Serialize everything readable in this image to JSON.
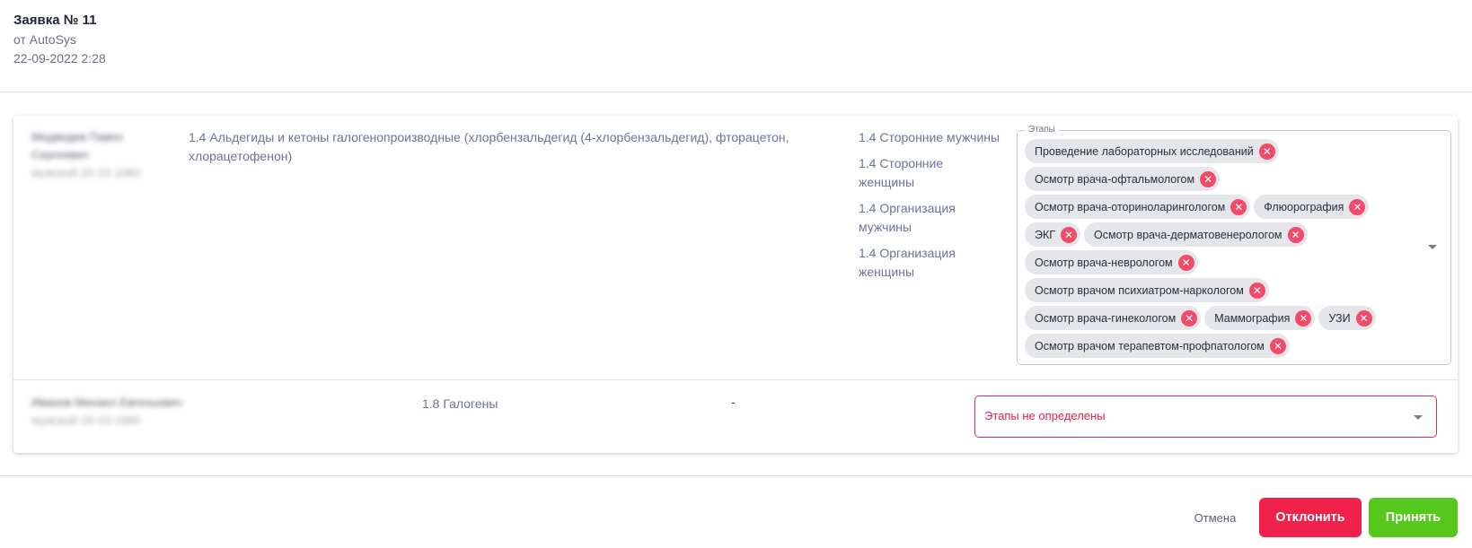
{
  "request": {
    "title": "Заявка № 11",
    "from": "от AutoSys",
    "date": "22-09-2022 2:28"
  },
  "rows": [
    {
      "person_name_line1": "Медведев Павел",
      "person_name_line2": "Сергеевич",
      "person_meta": "мужской 20-10-1980",
      "factor": "1.4 Альдегиды и кетоны галогенопроизводные (хлорбензальдегид (4-хлорбензальдегид), фторацетон, хлорацетофенон)",
      "groups": [
        "1.4 Сторонние мужчины",
        "1.4 Сторонние женщины",
        "1.4 Организация мужчины",
        "1.4 Организация женщины"
      ],
      "stages_label": "Этапы",
      "stages": [
        "Проведение лабораторных исследований",
        "Осмотр врача-офтальмологом",
        "Осмотр врача-оториноларингологом",
        "Флюорография",
        "ЭКГ",
        "Осмотр врача-дерматовенерологом",
        "Осмотр врача-неврологом",
        "Осмотр врачом психиатром-наркологом",
        "Осмотр врача-гинекологом",
        "Маммография",
        "УЗИ",
        "Осмотр врачом терапевтом-профпатологом"
      ]
    },
    {
      "person_name_line1": "Иванов Михаил Евгеньевич",
      "person_meta": "мужской 20-10-1980",
      "factor": "1.8 Галогены",
      "groups_placeholder": "-",
      "stages_error": "Этапы не определены"
    }
  ],
  "actions": {
    "cancel": "Отмена",
    "reject": "Отклонить",
    "accept": "Принять"
  },
  "colors": {
    "reject": "#f0214a",
    "accept": "#55c81b",
    "error": "#f0284f",
    "chip_remove": "#f24a68"
  },
  "icons": {
    "chip_remove": "close-circle-icon",
    "dropdown": "chevron-down-icon"
  }
}
